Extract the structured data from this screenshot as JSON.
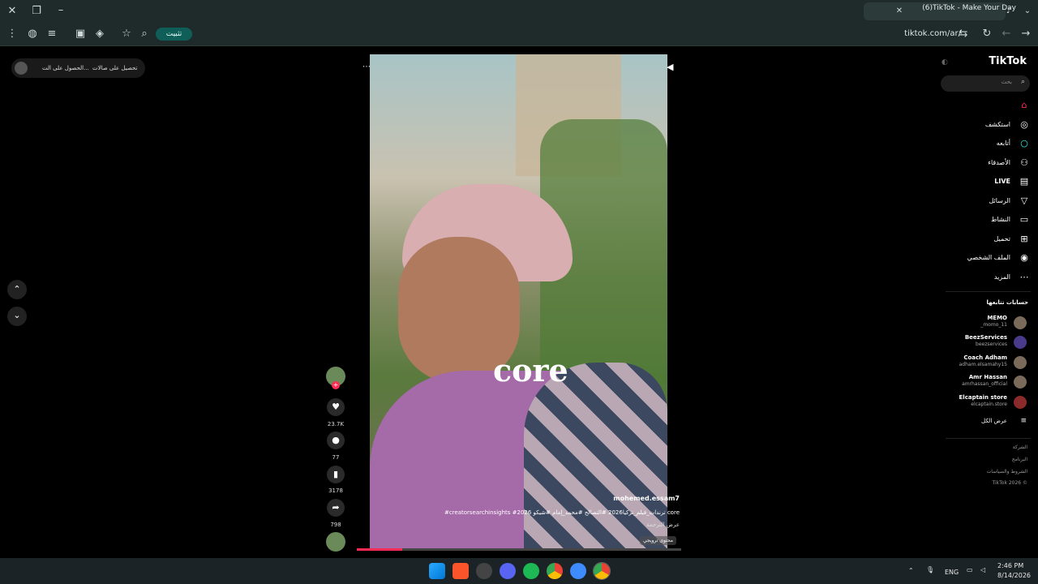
{
  "browser": {
    "tab_title": "(6)TikTok - Make Your Day",
    "pin_label": "تثبيت",
    "url": "tiktok.com/ar/"
  },
  "promo": {
    "item1": "تحصيل على صالات",
    "item2": "الحصول على الت..."
  },
  "video": {
    "overlay_word": "core",
    "author": "mohemed.essam7",
    "caption": "#creatorsearchinsights #ترندات_فيلم_تركيا2026 #التصالح #محمد_إمام #شيكو 2026 core",
    "translate": "عرض الترجمة",
    "promo_label": "محتوى ترويجي",
    "progress": 0.14
  },
  "actions": {
    "likes": "23.7K",
    "comments": "77",
    "saves": "3178",
    "shares": "798"
  },
  "sidebar": {
    "logo": "TikTok",
    "search_placeholder": "بحث",
    "nav": [
      {
        "label": "",
        "icon": "home-icon"
      },
      {
        "label": "استكشف",
        "icon": "compass-icon"
      },
      {
        "label": "أتابعه",
        "icon": "circle-icon"
      },
      {
        "label": "الأصدقاء",
        "icon": "friends-icon"
      },
      {
        "label": "LIVE",
        "icon": "live-icon"
      },
      {
        "label": "الرسائل",
        "icon": "messages-icon"
      },
      {
        "label": "النشاط",
        "icon": "activity-icon"
      },
      {
        "label": "تحميل",
        "icon": "upload-icon"
      },
      {
        "label": "الملف الشخصي",
        "icon": "profile-icon"
      },
      {
        "label": "المزيد",
        "icon": "more-icon"
      }
    ],
    "following_title": "حسابات تتابعها",
    "accounts": [
      {
        "name": "MEMO",
        "handle": "_momo_11"
      },
      {
        "name": "BeezServices",
        "handle": "beezservices"
      },
      {
        "name": "Coach Adham",
        "handle": "adham.elsamahy15"
      },
      {
        "name": "Amr Hassan",
        "handle": "amrhassan_official"
      },
      {
        "name": "Elcaptain store",
        "handle": "elcaptain.store"
      }
    ],
    "see_all": "عرض الكل",
    "footer": [
      "الشركة",
      "البرنامج",
      "الشروط والسياسات",
      "TikTok 2026 ©"
    ]
  },
  "taskbar": {
    "lang": "ENG",
    "time": "2:46 PM",
    "date": "8/14/2026"
  }
}
